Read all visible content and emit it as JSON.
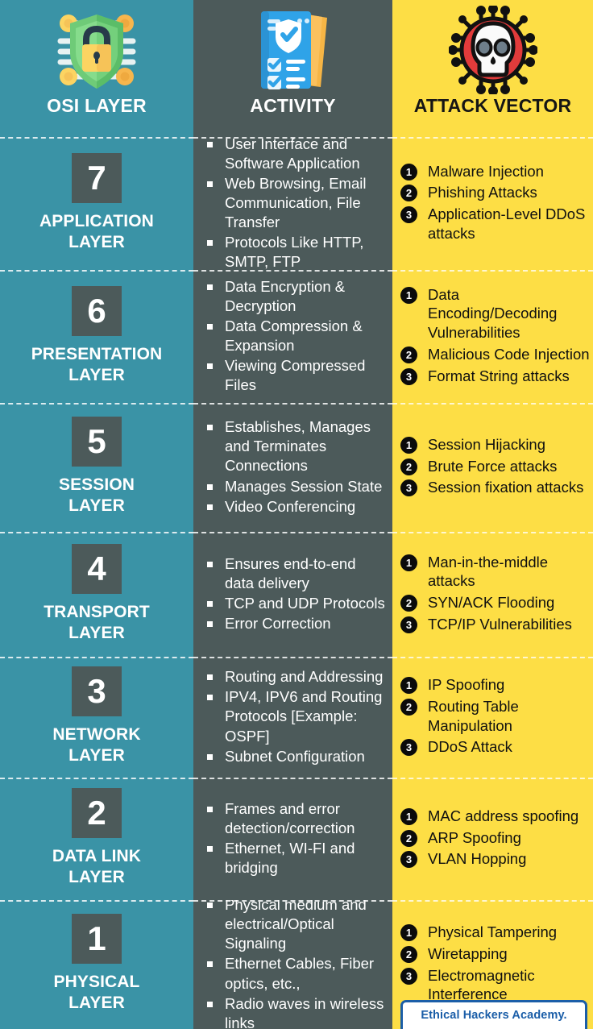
{
  "header": {
    "columns": [
      {
        "title": "OSI LAYER",
        "icon": "shield-lock-icon"
      },
      {
        "title": "ACTIVITY",
        "icon": "checklist-document-icon"
      },
      {
        "title": "ATTACK VECTOR",
        "icon": "skull-virus-icon"
      }
    ]
  },
  "colors": {
    "osi_column": "#3A93A6",
    "activity_column": "#4C5A5A",
    "attack_column": "#FDDE45",
    "layer_number_box": "#4C5A5A",
    "number_bullet": "#0B0B0B",
    "badge_accent": "#1B5EA8"
  },
  "rows": [
    {
      "number": "7",
      "layer": "APPLICATION\nLAYER",
      "activities": [
        "User Interface and Software Application",
        "Web Browsing, Email Communication, File Transfer",
        "Protocols Like HTTP, SMTP, FTP"
      ],
      "attacks": [
        {
          "n": "1",
          "text": "Malware Injection"
        },
        {
          "n": "2",
          "text": "Phishing Attacks"
        },
        {
          "n": "3",
          "text": "Application-Level DDoS attacks"
        }
      ]
    },
    {
      "number": "6",
      "layer": "PRESENTATION\nLAYER",
      "activities": [
        "Data Encryption & Decryption",
        "Data Compression & Expansion",
        "Viewing Compressed Files"
      ],
      "attacks": [
        {
          "n": "1",
          "text": "Data Encoding/Decoding Vulnerabilities"
        },
        {
          "n": "2",
          "text": "Malicious Code Injection"
        },
        {
          "n": "3",
          "text": "Format String attacks"
        }
      ]
    },
    {
      "number": "5",
      "layer": "SESSION\nLAYER",
      "activities": [
        "Establishes, Manages and Terminates Connections",
        "Manages Session State",
        "Video Conferencing"
      ],
      "attacks": [
        {
          "n": "1",
          "text": "Session Hijacking"
        },
        {
          "n": "2",
          "text": "Brute Force attacks"
        },
        {
          "n": "3",
          "text": "Session fixation attacks"
        }
      ]
    },
    {
      "number": "4",
      "layer": "TRANSPORT\nLAYER",
      "activities": [
        "Ensures end-to-end data delivery",
        "TCP and UDP Protocols",
        "Error Correction"
      ],
      "attacks": [
        {
          "n": "1",
          "text": "Man-in-the-middle attacks"
        },
        {
          "n": "2",
          "text": "SYN/ACK Flooding"
        },
        {
          "n": "3",
          "text": "TCP/IP Vulnerabilities"
        }
      ]
    },
    {
      "number": "3",
      "layer": "NETWORK\nLAYER",
      "activities": [
        "Routing and Addressing",
        "IPV4, IPV6 and Routing Protocols [Example: OSPF]",
        "Subnet Configuration"
      ],
      "attacks": [
        {
          "n": "1",
          "text": "IP Spoofing"
        },
        {
          "n": "2",
          "text": "Routing Table Manipulation"
        },
        {
          "n": "3",
          "text": "DDoS Attack"
        }
      ]
    },
    {
      "number": "2",
      "layer": "DATA LINK\nLAYER",
      "activities": [
        "Frames and error detection/correction",
        "Ethernet, WI-FI and bridging"
      ],
      "attacks": [
        {
          "n": "1",
          "text": "MAC address spoofing"
        },
        {
          "n": "2",
          "text": "ARP Spoofing"
        },
        {
          "n": "3",
          "text": "VLAN Hopping"
        }
      ]
    },
    {
      "number": "1",
      "layer": "PHYSICAL\nLAYER",
      "activities": [
        "Physical medium and electrical/Optical Signaling",
        "Ethernet Cables, Fiber optics, etc.,",
        "Radio waves in wireless links"
      ],
      "attacks": [
        {
          "n": "1",
          "text": "Physical Tampering"
        },
        {
          "n": "2",
          "text": "Wiretapping"
        },
        {
          "n": "3",
          "text": "Electromagnetic Interference"
        }
      ]
    }
  ],
  "footer": {
    "badge_label": "Ethical Hackers Academy."
  }
}
